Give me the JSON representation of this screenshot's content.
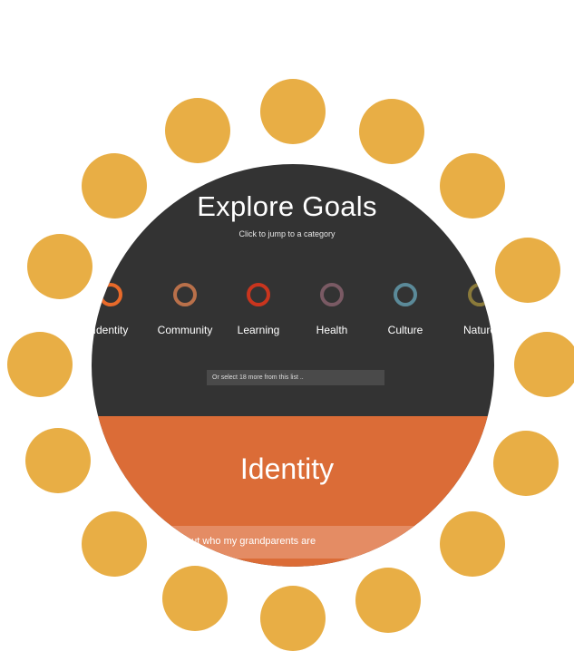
{
  "header": {
    "title": "Explore Goals",
    "subtitle": "Click to jump to a category"
  },
  "categories": [
    {
      "label": "Identity",
      "color": "#e86a2a"
    },
    {
      "label": "Community",
      "color": "#b9704a"
    },
    {
      "label": "Learning",
      "color": "#c9351e"
    },
    {
      "label": "Health",
      "color": "#7a5a64"
    },
    {
      "label": "Culture",
      "color": "#5b8a99"
    },
    {
      "label": "Nature",
      "color": "#8a7a3a"
    }
  ],
  "select": {
    "placeholder": "Or select 18 more from this list .."
  },
  "section": {
    "title": "Identity",
    "goal": "out who my grandparents are"
  },
  "colors": {
    "accent_dots": "#e8ae45",
    "panel": "#333333",
    "section": "#db6c37"
  }
}
